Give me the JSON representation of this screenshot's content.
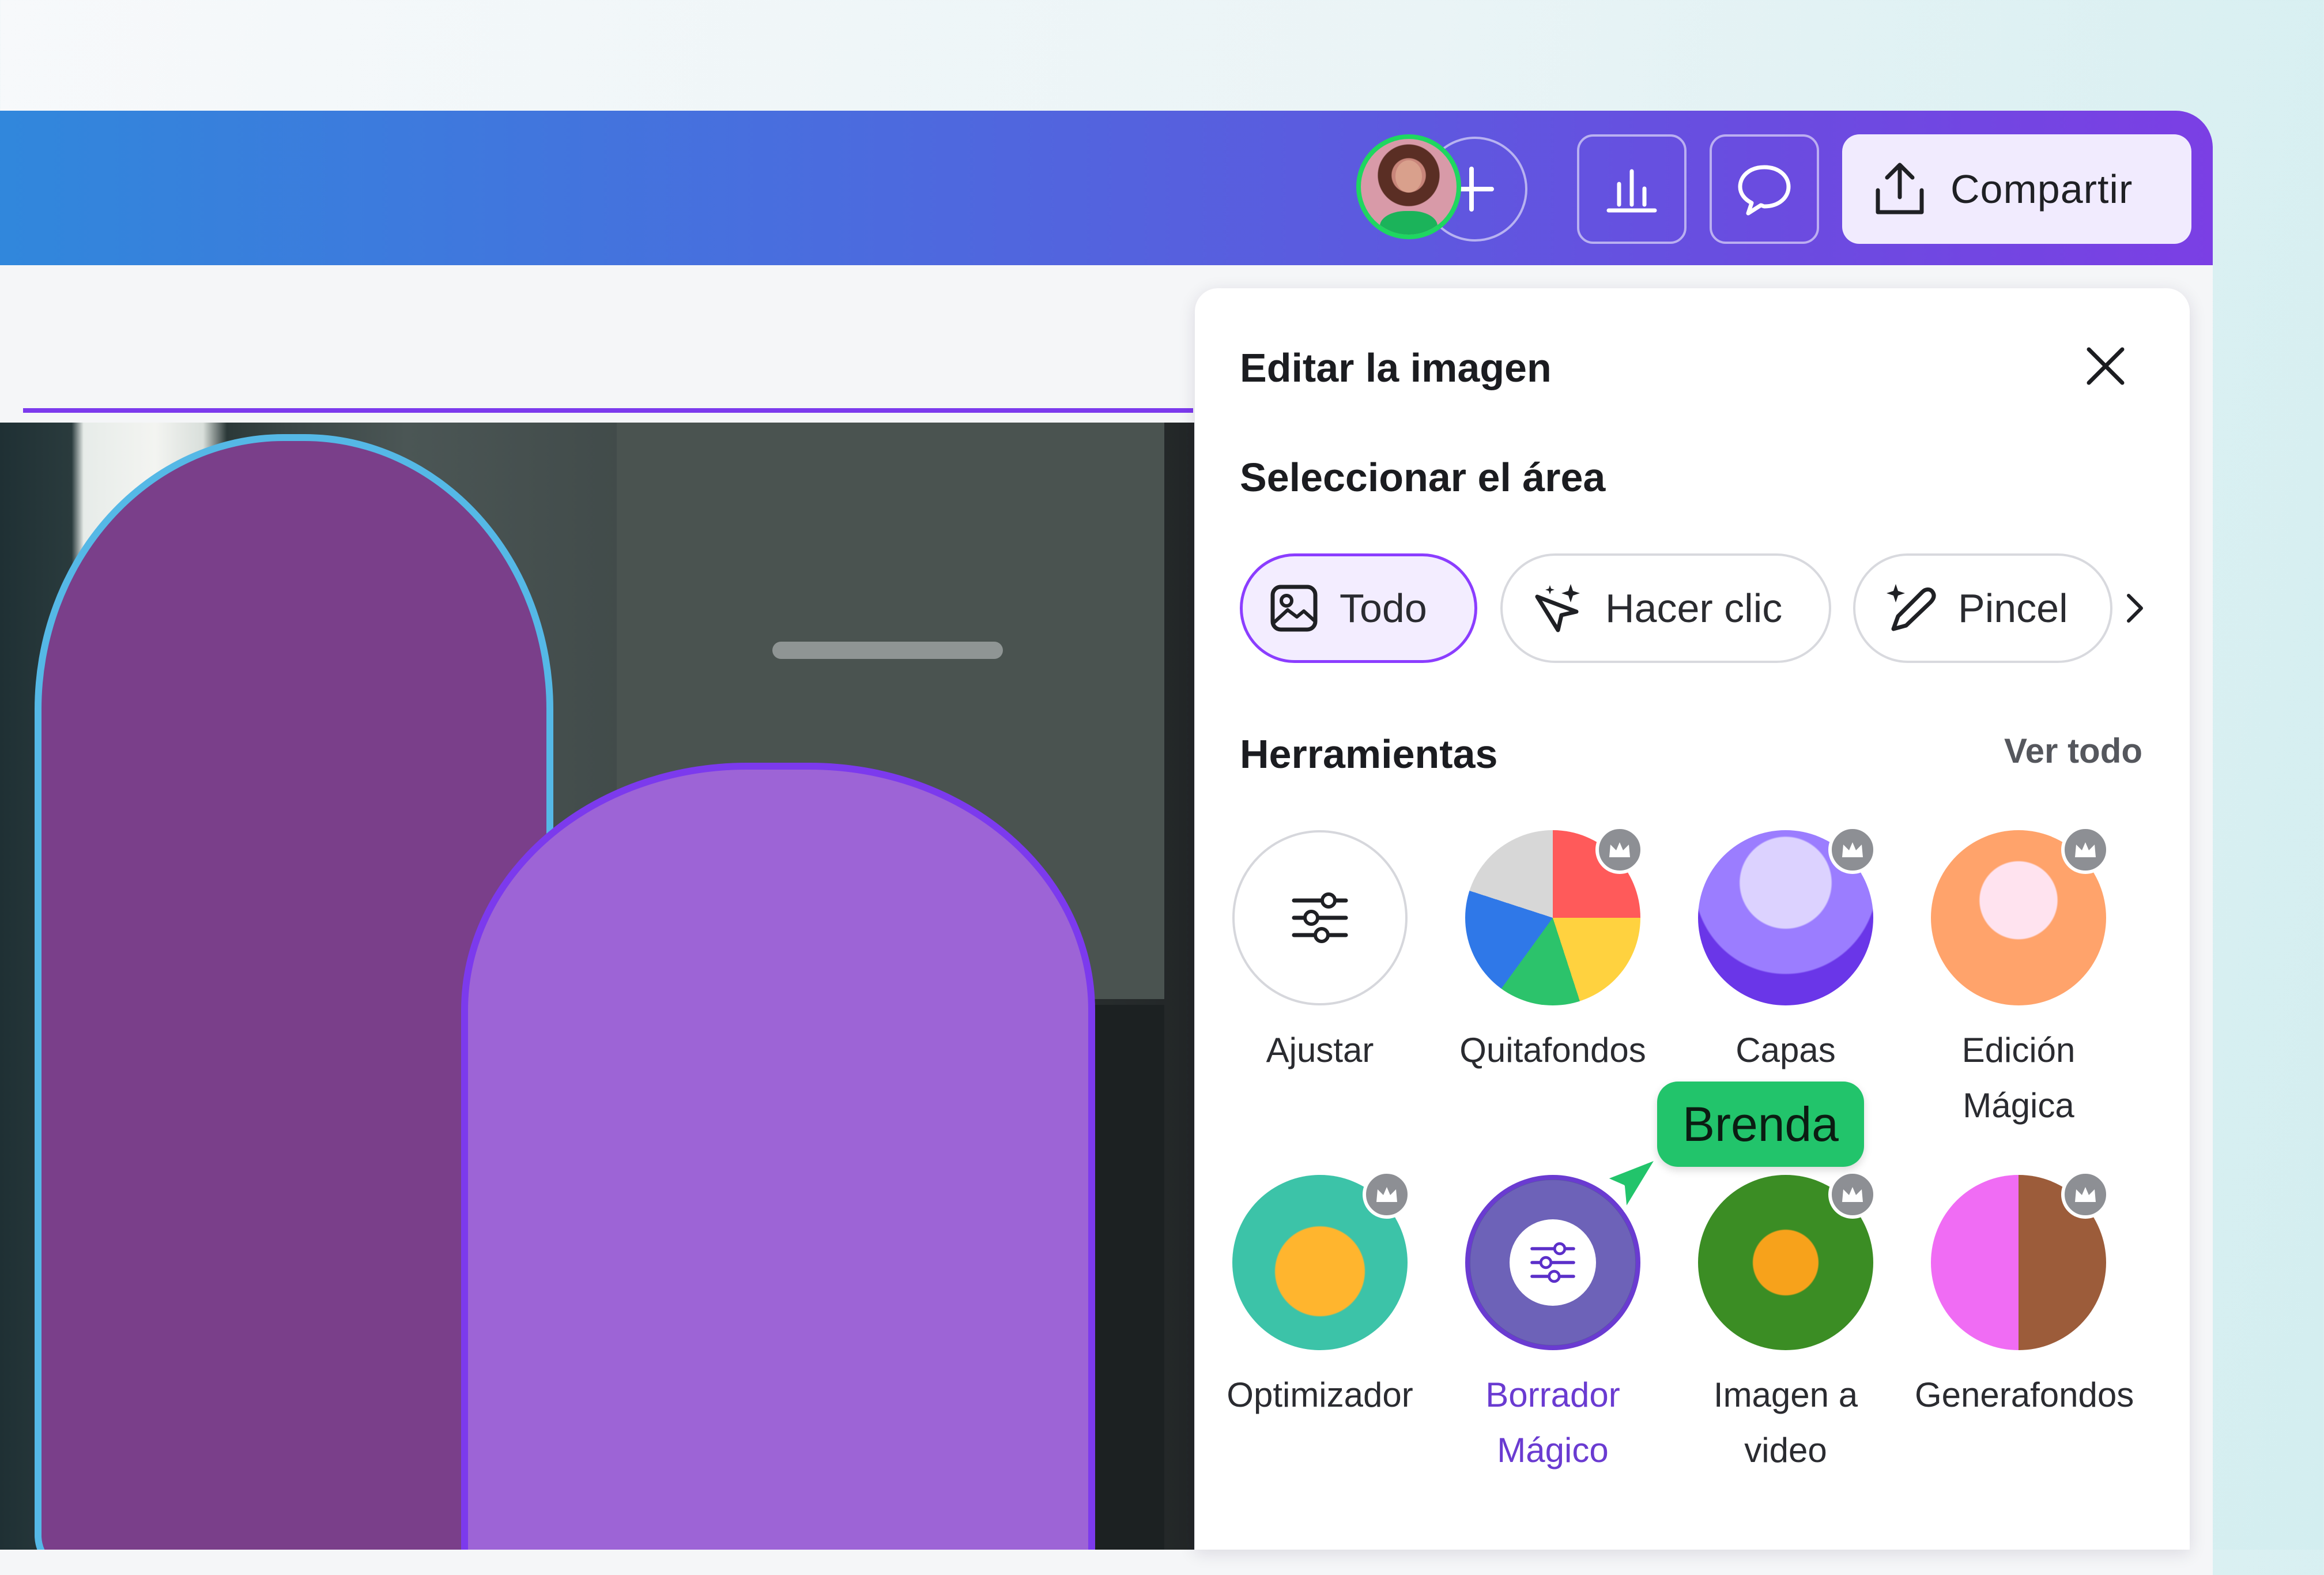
{
  "colors": {
    "accent": "#8b3dff",
    "topbar_start": "#3088dc",
    "topbar_end": "#7b3fe4",
    "cursor": "#22c46b"
  },
  "topbar": {
    "avatar_icon": "user-avatar",
    "add_icon": "plus-icon",
    "insights_icon": "bar-chart-icon",
    "comment_icon": "speech-bubble-icon",
    "share_icon": "upload-icon",
    "share_label": "Compartir"
  },
  "panel": {
    "title": "Editar la imagen",
    "close_icon": "close-icon",
    "select_area_title": "Seleccionar el área",
    "select_options": [
      {
        "label": "Todo",
        "icon": "image-icon",
        "selected": true
      },
      {
        "label": "Hacer clic",
        "icon": "magic-pointer-icon",
        "selected": false
      },
      {
        "label": "Pincel",
        "icon": "magic-brush-icon",
        "selected": false
      }
    ],
    "more_icon": "chevron-right-icon",
    "tools_title": "Herramientas",
    "see_all": "Ver todo",
    "tools": [
      {
        "label": "Ajustar",
        "icon": "sliders-icon",
        "premium": false
      },
      {
        "label": "Quitafondos",
        "icon": "beach-ball-icon",
        "premium": true
      },
      {
        "label": "Capas",
        "icon": "butterfly-layers-icon",
        "premium": true
      },
      {
        "label": "Edición Mágica",
        "icon": "cupcake-icon",
        "premium": true
      },
      {
        "label": "Optimizador",
        "icon": "pineapple-icon",
        "premium": true
      },
      {
        "label": "Borrador Mágico",
        "icon": "sliders-icon",
        "premium": false
      },
      {
        "label": "Imagen a video",
        "icon": "butterfly-flower-icon",
        "premium": true
      },
      {
        "label": "Generafondos",
        "icon": "sunglasses-icon",
        "premium": true
      }
    ]
  },
  "collaborator": {
    "name": "Brenda"
  }
}
